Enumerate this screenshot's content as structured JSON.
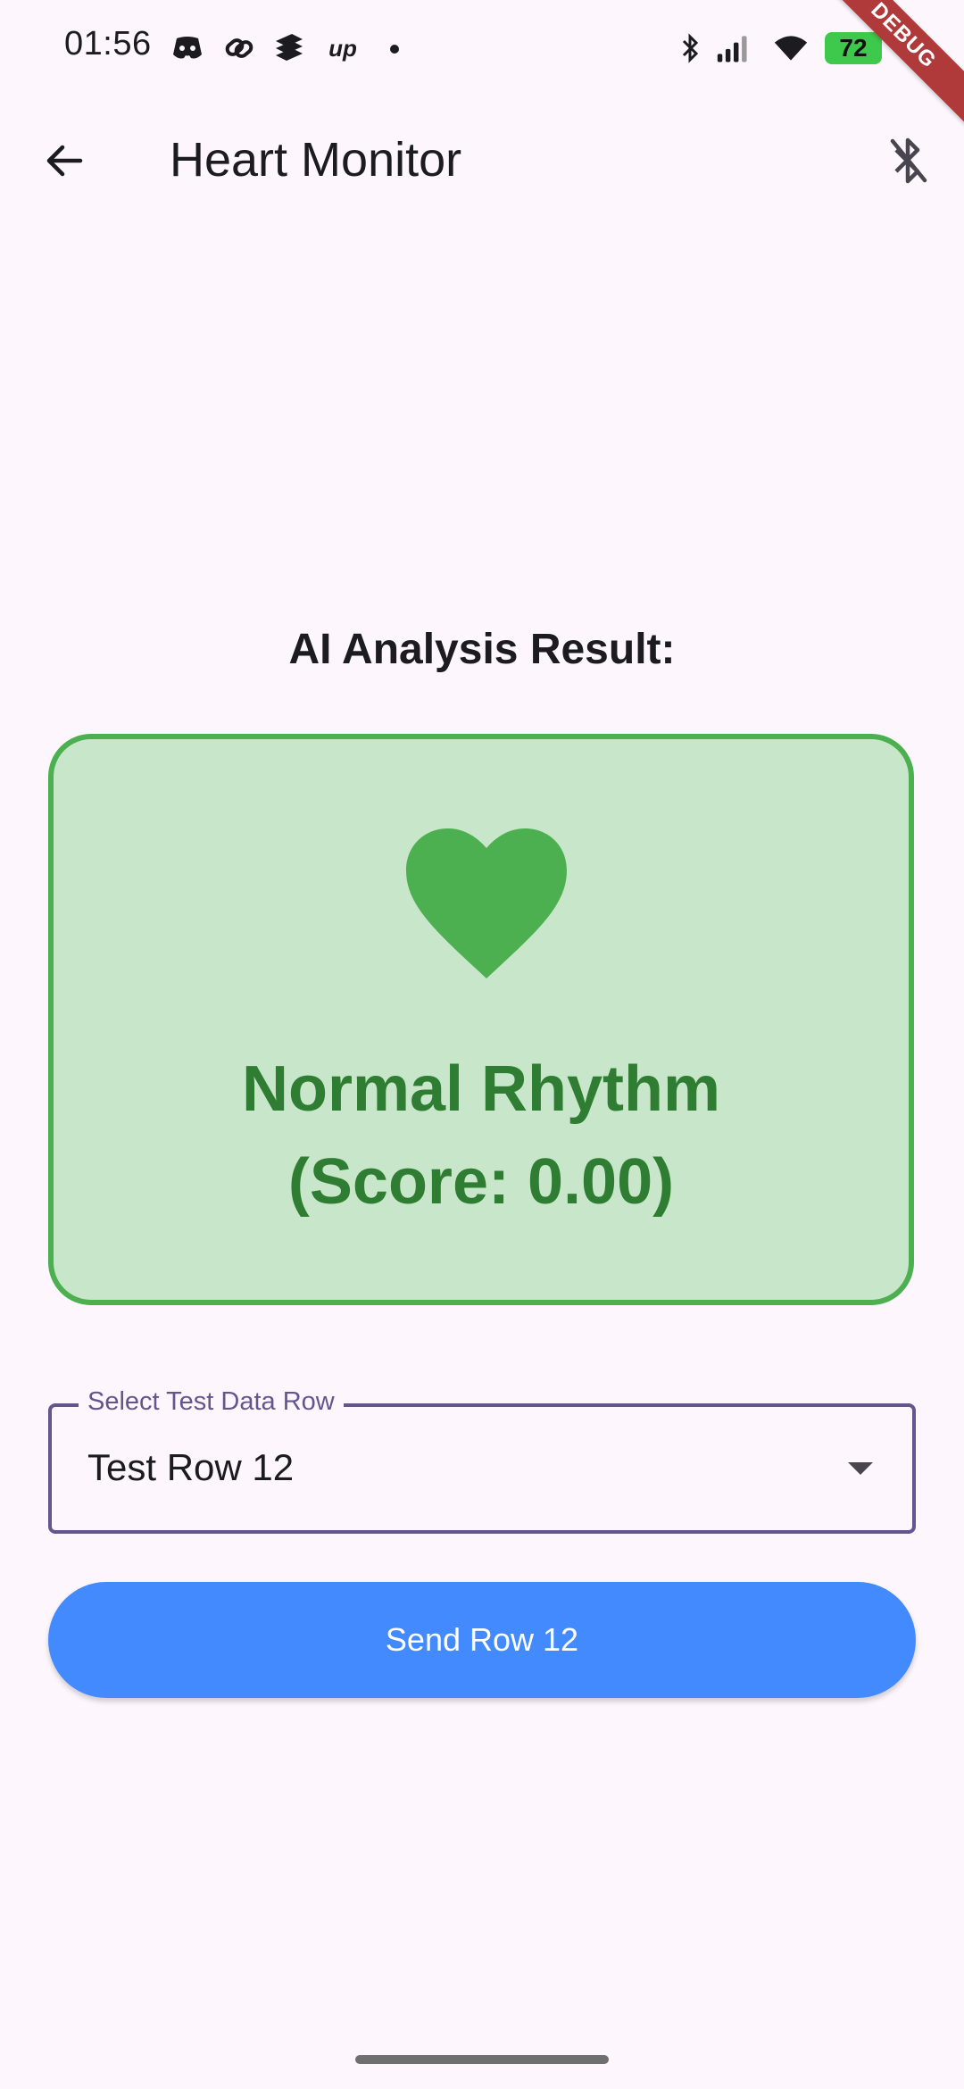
{
  "status_bar": {
    "time": "01:56",
    "notification_icons": [
      "discord-icon",
      "link-icon",
      "stack-icon",
      "up-icon"
    ],
    "system_icons": [
      "bluetooth-icon",
      "signal-icon",
      "wifi-icon"
    ],
    "battery": "72"
  },
  "debug_banner": "DEBUG",
  "app_bar": {
    "title": "Heart Monitor",
    "back_icon": "arrow-back-icon",
    "action_icon": "bluetooth-disabled-icon"
  },
  "analysis": {
    "heading": "AI Analysis Result:",
    "status_line1": "Normal Rhythm",
    "status_line2": "(Score: 0.00)",
    "icon": "heart-icon"
  },
  "dropdown": {
    "label": "Select Test Data Row",
    "selected": "Test Row 12"
  },
  "send_button": {
    "label": "Send Row 12"
  },
  "colors": {
    "background": "#fdf7fd",
    "card_fill": "#c8e6c9",
    "card_border": "#4caf50",
    "result_text": "#2e7d32",
    "dropdown_accent": "#65558f",
    "button": "#448aff",
    "battery": "#3ec94c",
    "debug_ribbon": "#b03a3a"
  }
}
